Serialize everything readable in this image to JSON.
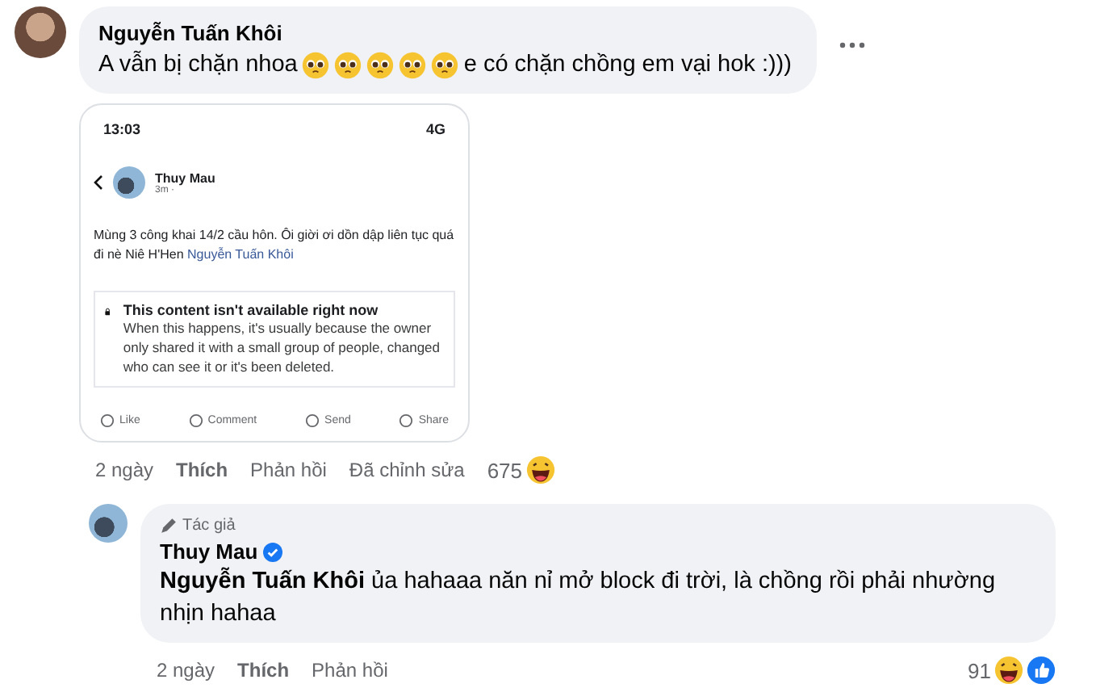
{
  "comment": {
    "author": "Nguyễn Tuấn Khôi",
    "segments": [
      {
        "kind": "text",
        "text": "A vẫn bị chặn nhoa"
      },
      {
        "kind": "emoji"
      },
      {
        "kind": "emoji"
      },
      {
        "kind": "emoji"
      },
      {
        "kind": "emoji"
      },
      {
        "kind": "emoji"
      },
      {
        "kind": "text",
        "text": "e có chặn chồng em vại hok :)))"
      }
    ],
    "shared_screenshot": {
      "time": "13:03",
      "network": "4G",
      "poster": "Thuy Mau",
      "post_time": "3m ·",
      "post_text": "Mùng 3 công khai 14/2 cầu hôn.  Ôi giời ơi dồn dập liên tục quá đi nè Niê H'Hen",
      "post_link": "Nguyễn Tuấn Khôi",
      "notice_title": "This content isn't available right now",
      "notice_body": "When this happens, it's usually because the owner only shared it with a small group of people, changed who can see it or it's been deleted.",
      "actions": [
        "Like",
        "Comment",
        "Send",
        "Share"
      ]
    },
    "actions": [
      {
        "kind": "time",
        "text": "2 ngày"
      },
      {
        "kind": "like",
        "text": "Thích"
      },
      {
        "kind": "reply",
        "text": "Phản hồi"
      },
      {
        "kind": "edited",
        "text": "Đã chỉnh sửa"
      }
    ],
    "reaction_count": "675"
  },
  "reply": {
    "badge": "Tác giả",
    "author": "Thuy Mau",
    "verified": true,
    "text": "**Nguyễn Tuấn Khôi** ủa hahaaa năn nỉ mở block đi trời, là chồng rồi phải nhường nhịn hahaa",
    "actions": [
      {
        "kind": "time",
        "text": "2 ngày"
      },
      {
        "kind": "like",
        "text": "Thích"
      },
      {
        "kind": "reply",
        "text": "Phản hồi"
      }
    ],
    "reaction_count": "91"
  }
}
